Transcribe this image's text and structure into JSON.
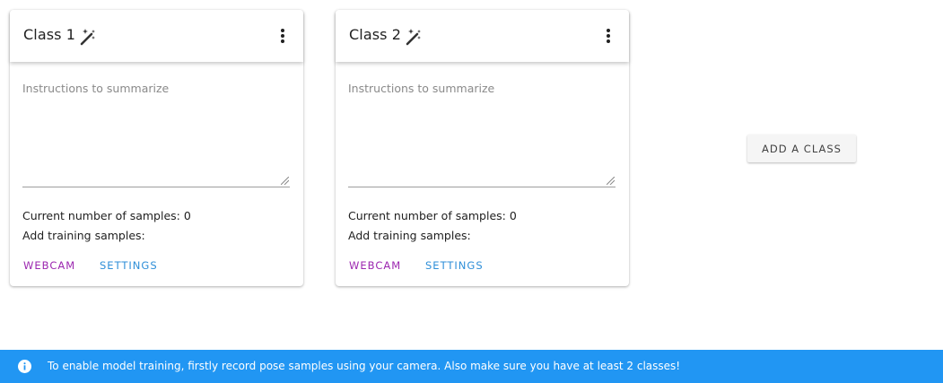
{
  "colors": {
    "banner_bg": "#2196f3",
    "webcam_text": "#9c27b0",
    "settings_text": "#2f8fd8"
  },
  "classes": [
    {
      "title": "Class 1",
      "instructions_placeholder": "Instructions to summarize",
      "sample_count_text": "Current number of samples: 0",
      "add_samples_label": "Add training samples:",
      "webcam_label": "WEBCAM",
      "settings_label": "SETTINGS",
      "edit_icon": "magic-wand-icon",
      "menu_icon": "more-vert-icon"
    },
    {
      "title": "Class 2",
      "instructions_placeholder": "Instructions to summarize",
      "sample_count_text": "Current number of samples: 0",
      "add_samples_label": "Add training samples:",
      "webcam_label": "WEBCAM",
      "settings_label": "SETTINGS",
      "edit_icon": "magic-wand-icon",
      "menu_icon": "more-vert-icon"
    }
  ],
  "add_class_label": "ADD A CLASS",
  "banner": {
    "icon": "info-icon",
    "text": "To enable model training, firstly record pose samples using your camera. Also make sure you have at least 2 classes!"
  }
}
